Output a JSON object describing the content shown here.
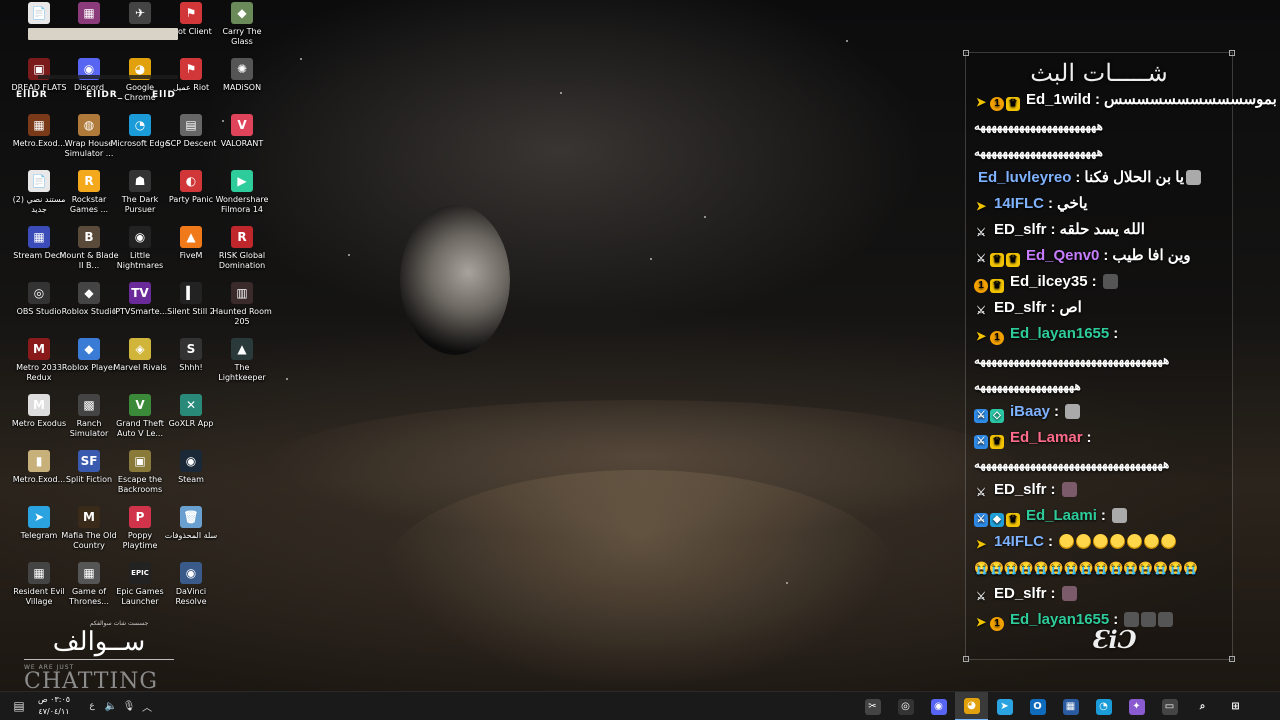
{
  "desktop_icons": [
    {
      "label": "",
      "glyph": "📄",
      "color": "#e8e8e8"
    },
    {
      "label": "",
      "glyph": "▦",
      "color": "#8b3a7a"
    },
    {
      "label": "",
      "glyph": "✈",
      "color": "#444444"
    },
    {
      "label": "Riot Client",
      "glyph": "⚑",
      "color": "#d13639"
    },
    {
      "label": "Carry The Glass",
      "glyph": "◆",
      "color": "#6b8a5a"
    },
    {
      "label": "DREAD FLATS",
      "glyph": "▣",
      "color": "#7a1a1a"
    },
    {
      "label": "Discord",
      "glyph": "◉",
      "color": "#5865f2"
    },
    {
      "label": "Google Chrome",
      "glyph": "◕",
      "color": "#e0a10d"
    },
    {
      "label": "عميل Riot",
      "glyph": "⚑",
      "color": "#d13639"
    },
    {
      "label": "MADiSON",
      "glyph": "✺",
      "color": "#555555"
    },
    {
      "label": "Metro.Exod...",
      "glyph": "▦",
      "color": "#7a3a1a"
    },
    {
      "label": "Wrap House Simulator ...",
      "glyph": "◍",
      "color": "#b07a3a"
    },
    {
      "label": "Microsoft Edge",
      "glyph": "◔",
      "color": "#1b9bd8"
    },
    {
      "label": "SCP Descent",
      "glyph": "▤",
      "color": "#666666"
    },
    {
      "label": "VALORANT",
      "glyph": "V",
      "color": "#e0445a"
    },
    {
      "label": "مستند نصي (2) جديد",
      "glyph": "📄",
      "color": "#e8e8e8"
    },
    {
      "label": "Rockstar Games ...",
      "glyph": "R",
      "color": "#f3a91b"
    },
    {
      "label": "The Dark Pursuer",
      "glyph": "☗",
      "color": "#333333"
    },
    {
      "label": "Party Panic",
      "glyph": "◐",
      "color": "#d13639"
    },
    {
      "label": "Wondershare Filmora 14",
      "glyph": "▶",
      "color": "#2ecc9a"
    },
    {
      "label": "Stream Deck",
      "glyph": "▦",
      "color": "#3b4cb8"
    },
    {
      "label": "Mount & Blade II B...",
      "glyph": "B",
      "color": "#5a4a3a"
    },
    {
      "label": "Little Nightmares",
      "glyph": "◉",
      "color": "#222222"
    },
    {
      "label": "FiveM",
      "glyph": "▲",
      "color": "#f07a1a"
    },
    {
      "label": "RISK Global Domination",
      "glyph": "R",
      "color": "#c0272d"
    },
    {
      "label": "OBS Studio",
      "glyph": "◎",
      "color": "#333333"
    },
    {
      "label": "Roblox Studio",
      "glyph": "◆",
      "color": "#444444"
    },
    {
      "label": "IPTVSmarte...",
      "glyph": "TV",
      "color": "#6a2a9a"
    },
    {
      "label": "Silent Still 2",
      "glyph": "▍",
      "color": "#222222"
    },
    {
      "label": "Haunted Room 205",
      "glyph": "▥",
      "color": "#3a2a2a"
    },
    {
      "label": "Metro 2033 Redux",
      "glyph": "M",
      "color": "#8a1a1a"
    },
    {
      "label": "Roblox Player",
      "glyph": "◆",
      "color": "#3a7bd5"
    },
    {
      "label": "Marvel Rivals",
      "glyph": "◈",
      "color": "#d1b43a"
    },
    {
      "label": "Shhh!",
      "glyph": "S",
      "color": "#333333"
    },
    {
      "label": "The Lightkeeper",
      "glyph": "▲",
      "color": "#2a3a3a"
    },
    {
      "label": "Metro Exodus",
      "glyph": "M",
      "color": "#dddddd"
    },
    {
      "label": "Ranch Simulator",
      "glyph": "▩",
      "color": "#444444"
    },
    {
      "label": "Grand Theft Auto V Le...",
      "glyph": "V",
      "color": "#3a8a3a"
    },
    {
      "label": "GoXLR App",
      "glyph": "✕",
      "color": "#2a8a7a"
    },
    {
      "label": "",
      "glyph": "",
      "color": "transparent"
    },
    {
      "label": "Metro.Exod...",
      "glyph": "▮",
      "color": "#c8b07a"
    },
    {
      "label": "Split Fiction",
      "glyph": "SF",
      "color": "#3a5ab0"
    },
    {
      "label": "Escape the Backrooms",
      "glyph": "▣",
      "color": "#8a7a3a"
    },
    {
      "label": "Steam",
      "glyph": "◉",
      "color": "#1b2838"
    },
    {
      "label": "",
      "glyph": "",
      "color": "transparent"
    },
    {
      "label": "Telegram",
      "glyph": "➤",
      "color": "#2aa3e0"
    },
    {
      "label": "Mafia The Old Country",
      "glyph": "M",
      "color": "#3a2a1a"
    },
    {
      "label": "Poppy Playtime",
      "glyph": "P",
      "color": "#d1344a"
    },
    {
      "label": "سلة المحذوفات",
      "glyph": "🗑",
      "color": "#6aa0d0"
    },
    {
      "label": "",
      "glyph": "",
      "color": "transparent"
    },
    {
      "label": "Resident Evil Village",
      "glyph": "▦",
      "color": "#444444"
    },
    {
      "label": "Game of Thrones...",
      "glyph": "▦",
      "color": "#555555"
    },
    {
      "label": "Epic Games Launcher",
      "glyph": "EPIC",
      "color": "#222222"
    },
    {
      "label": "DaVinci Resolve",
      "glyph": "◉",
      "color": "#3a5a8a"
    }
  ],
  "overlay_tags": [
    "EllDR",
    "EllDR_",
    "EllD"
  ],
  "brand": {
    "small": "جسست شات سوالفكم",
    "arabic": "ســوالف",
    "tagline": "WE ARE JUST",
    "big": "CHATTING"
  },
  "chat": {
    "title": "شـــــات البث",
    "logo": "ƐiƆ",
    "messages": [
      {
        "badges": [
          "arrow",
          "one",
          "crown"
        ],
        "user": "Ed_1wild",
        "color": "#ffffff",
        "text": "بموسسسسسسسسسسس",
        "cont": [
          "ههههههههههههههههههههههه",
          "ههههههههههههههههههههههه"
        ],
        "emotes": []
      },
      {
        "badges": [],
        "user": "Ed_luvleyreo",
        "color": "#7fb2ff",
        "text": "يا بن الحلال فكنا",
        "cont": [],
        "emotes": [
          "cat"
        ]
      },
      {
        "badges": [
          "arrow"
        ],
        "user": "14IFLC",
        "color": "#7fb2ff",
        "text": "ياخي",
        "cont": [],
        "emotes": []
      },
      {
        "badges": [
          "sword"
        ],
        "user": "ED_slfr",
        "color": "#ffffff",
        "text": "الله يسد حلقه",
        "cont": [],
        "emotes": []
      },
      {
        "badges": [
          "sword",
          "crown",
          "crown"
        ],
        "user": "Ed_Qenv0",
        "color": "#c77dff",
        "text": "وين افا طيب",
        "cont": [],
        "emotes": []
      },
      {
        "badges": [
          "one",
          "crown"
        ],
        "user": "Ed_ilcey35",
        "color": "#ffffff",
        "text": "",
        "cont": [],
        "emotes": [
          "bow"
        ]
      },
      {
        "badges": [
          "sword"
        ],
        "user": "ED_slfr",
        "color": "#ffffff",
        "text": "اص",
        "cont": [],
        "emotes": []
      },
      {
        "badges": [
          "arrow",
          "one"
        ],
        "user": "Ed_layan1655",
        "color": "#2ecc9a",
        "text": "",
        "cont": [
          "ههههههههههههههههههههههههههههههههههه",
          "ههههههههههههههههههه"
        ],
        "emotes": []
      },
      {
        "badges": [
          "mod",
          "vip"
        ],
        "user": "iBaay",
        "color": "#7fb2ff",
        "text": "",
        "cont": [],
        "emotes": [
          "cat"
        ]
      },
      {
        "badges": [
          "mod",
          "crown"
        ],
        "user": "Ed_Lamar",
        "color": "#ff6b8a",
        "text": "",
        "cont": [
          "ههههههههههههههههههههههههههههههههههه"
        ],
        "emotes": []
      },
      {
        "badges": [
          "sword"
        ],
        "user": "ED_slfr",
        "color": "#ffffff",
        "text": "",
        "cont": [],
        "emotes": [
          "pic"
        ]
      },
      {
        "badges": [
          "mod",
          "cube",
          "crown"
        ],
        "user": "Ed_Laami",
        "color": "#2ecc9a",
        "text": "",
        "cont": [],
        "emotes": [
          "cat"
        ]
      },
      {
        "badges": [
          "arrow"
        ],
        "user": "14IFLC",
        "color": "#7fb2ff",
        "text": "",
        "cont": [
          "😭😭😭😭😭😭😭😭😭😭😭😭😭😭😭"
        ],
        "emotes": [
          "cry",
          "cry",
          "cry",
          "cry",
          "cry",
          "cry",
          "cry"
        ]
      },
      {
        "badges": [
          "sword"
        ],
        "user": "ED_slfr",
        "color": "#ffffff",
        "text": "",
        "cont": [],
        "emotes": [
          "pic"
        ]
      },
      {
        "badges": [
          "arrow",
          "one"
        ],
        "user": "Ed_layan1655",
        "color": "#2ecc9a",
        "text": "",
        "cont": [],
        "emotes": [
          "bow",
          "bow",
          "bow"
        ]
      }
    ]
  },
  "taskbar": {
    "clock_time": "٠٣:٠٥ ص",
    "clock_date": "٤٧/٠٤/١١",
    "lang": "ع",
    "apps": [
      {
        "name": "snipping",
        "glyph": "✂",
        "color": "#444444"
      },
      {
        "name": "obs",
        "glyph": "◎",
        "color": "#333333"
      },
      {
        "name": "discord",
        "glyph": "◉",
        "color": "#5865f2"
      },
      {
        "name": "chrome",
        "glyph": "◕",
        "color": "#e0a10d"
      },
      {
        "name": "telegram",
        "glyph": "➤",
        "color": "#2aa3e0"
      },
      {
        "name": "outlook",
        "glyph": "O",
        "color": "#0f6cbd"
      },
      {
        "name": "store",
        "glyph": "▦",
        "color": "#2a5aa0"
      },
      {
        "name": "edge",
        "glyph": "◔",
        "color": "#1b9bd8"
      },
      {
        "name": "copilot",
        "glyph": "✦",
        "color": "#8a5ad0"
      },
      {
        "name": "task-view",
        "glyph": "▭",
        "color": "#444444"
      },
      {
        "name": "search",
        "glyph": "⌕",
        "color": "transparent"
      },
      {
        "name": "start",
        "glyph": "⊞",
        "color": "transparent"
      }
    ]
  }
}
